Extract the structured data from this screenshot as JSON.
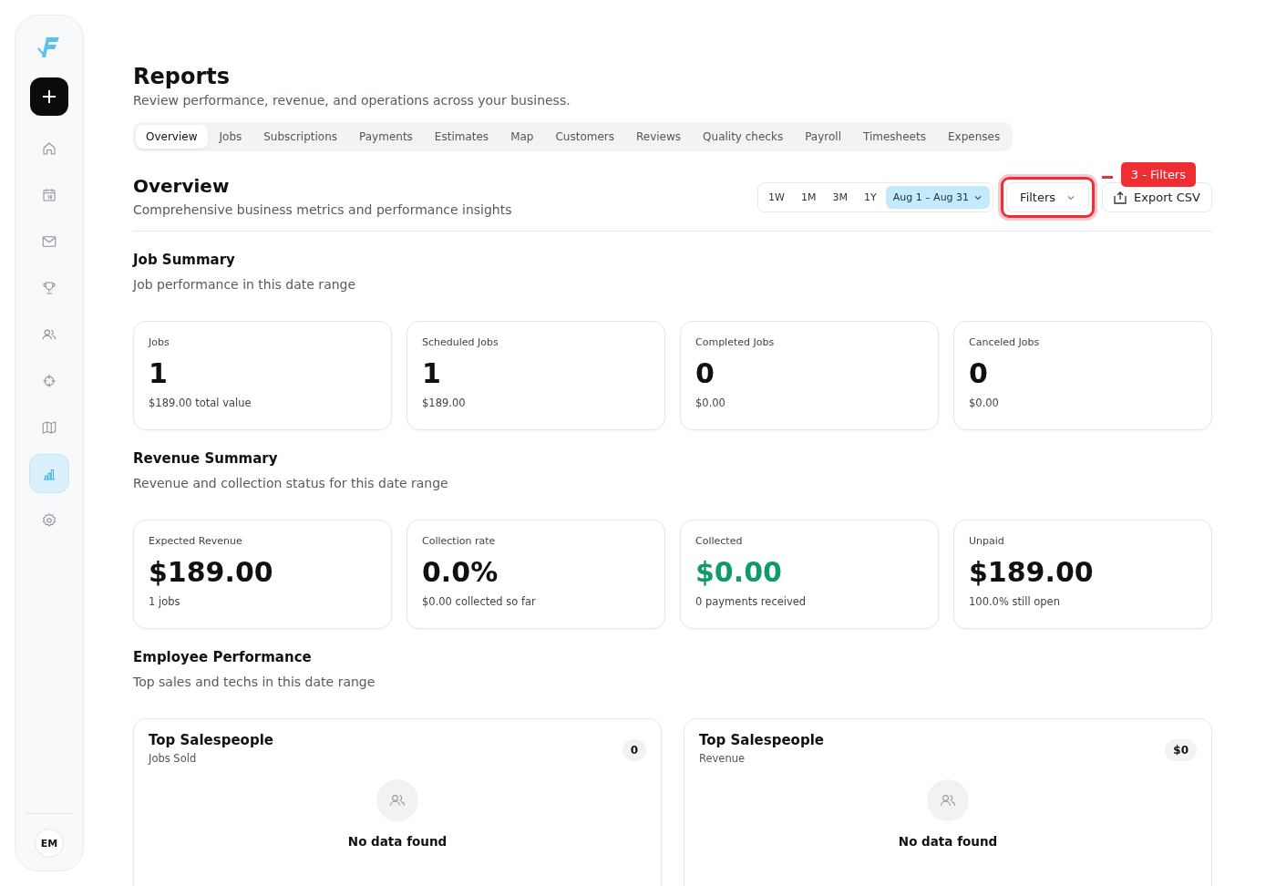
{
  "sidebar": {
    "items": [
      {
        "selected": false
      },
      {
        "selected": false
      },
      {
        "selected": false
      },
      {
        "selected": false
      },
      {
        "selected": false
      },
      {
        "selected": false
      },
      {
        "selected": false
      },
      {
        "selected": true
      },
      {
        "selected": false
      }
    ],
    "avatar": "EM"
  },
  "page": {
    "title": "Reports",
    "subtitle": "Review performance, revenue, and operations across your business."
  },
  "tabs": [
    {
      "label": "Overview",
      "selected": true
    },
    {
      "label": "Jobs",
      "selected": false
    },
    {
      "label": "Subscriptions",
      "selected": false
    },
    {
      "label": "Payments",
      "selected": false
    },
    {
      "label": "Estimates",
      "selected": false
    },
    {
      "label": "Map",
      "selected": false
    },
    {
      "label": "Customers",
      "selected": false
    },
    {
      "label": "Reviews",
      "selected": false
    },
    {
      "label": "Quality checks",
      "selected": false
    },
    {
      "label": "Payroll",
      "selected": false
    },
    {
      "label": "Timesheets",
      "selected": false
    },
    {
      "label": "Expenses",
      "selected": false
    }
  ],
  "overview": {
    "title": "Overview",
    "subtitle": "Comprehensive business metrics and performance insights",
    "ranges": [
      {
        "label": "1W",
        "selected": false
      },
      {
        "label": "1M",
        "selected": false
      },
      {
        "label": "3M",
        "selected": false
      },
      {
        "label": "1Y",
        "selected": false
      },
      {
        "label": "Aug 1 – Aug 31",
        "selected": true
      }
    ],
    "filters": "Filters",
    "export": "Export CSV",
    "annotation": "3 - Filters"
  },
  "sections": [
    {
      "title": "Job Summary",
      "subtitle": "Job performance in this date range",
      "kind": "metrics",
      "cards": [
        {
          "label": "Jobs",
          "value": "1",
          "note": "$189.00 total value",
          "color": "#111111"
        },
        {
          "label": "Scheduled Jobs",
          "value": "1",
          "note": "$189.00",
          "color": "#111111"
        },
        {
          "label": "Completed Jobs",
          "value": "0",
          "note": "$0.00",
          "color": "#111111"
        },
        {
          "label": "Canceled Jobs",
          "value": "0",
          "note": "$0.00",
          "color": "#111111"
        }
      ]
    },
    {
      "title": "Revenue Summary",
      "subtitle": "Revenue and collection status for this date range",
      "kind": "metrics",
      "cards": [
        {
          "label": "Expected Revenue",
          "value": "$189.00",
          "note": "1 jobs",
          "color": "#111111"
        },
        {
          "label": "Collection rate",
          "value": "0.0%",
          "note": "$0.00 collected so far",
          "color": "#111111"
        },
        {
          "label": "Collected",
          "value": "$0.00",
          "note": "0 payments received",
          "color": "#0e9a6a"
        },
        {
          "label": "Unpaid",
          "value": "$189.00",
          "note": "100.0% still open",
          "color": "#111111"
        }
      ]
    },
    {
      "title": "Employee Performance",
      "subtitle": "Top sales and techs in this date range",
      "kind": "leaders",
      "cards": [
        {
          "label": "Top Salespeople",
          "note": "Jobs Sold",
          "badge": "0",
          "empty": "No data found"
        },
        {
          "label": "Top Salespeople",
          "note": "Revenue",
          "badge": "$0",
          "empty": "No data found"
        }
      ]
    }
  ]
}
